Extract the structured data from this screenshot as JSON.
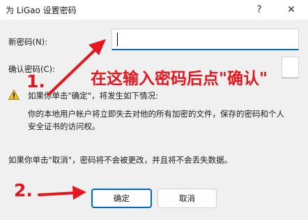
{
  "window": {
    "title": "为 LiGao 设置密码",
    "help_glyph": "?",
    "close_glyph": "✕"
  },
  "form": {
    "new_password_label": "新密码(N):",
    "confirm_password_label": "确认密码(C):",
    "new_password_value": "",
    "confirm_password_value": ""
  },
  "warning": {
    "icon": "warning-icon",
    "line1": "如果你单击\"确定\"，将发生如下情况:",
    "detail_line1": "你的本地用户帐户将立即失去对他的所有加密的文件，保存的密码和个人",
    "detail_line2": "安全证书的访问权。"
  },
  "cancel_note": "如果你单击\"取消\"，密码将不会被更改，并且将不会丢失数据。",
  "buttons": {
    "ok_label": "确定",
    "cancel_label": "取消"
  },
  "annotations": {
    "step1": "1.",
    "step2": "2.",
    "instruction": "在这输入密码后点\"确认\"",
    "color": "#e5161d"
  }
}
